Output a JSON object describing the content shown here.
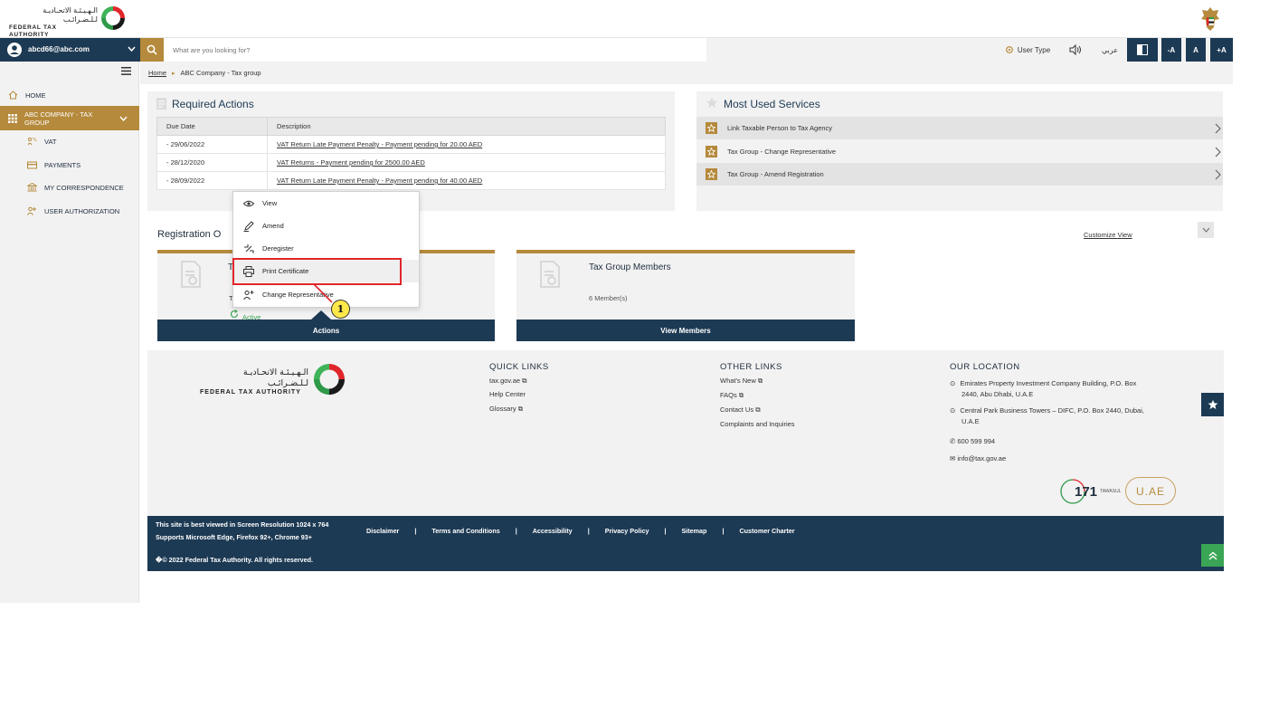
{
  "user": {
    "email": "abcd66@abc.com"
  },
  "search": {
    "placeholder": "What are you looking for?"
  },
  "header_controls": {
    "user_type": "User Type",
    "arabic": "عربي",
    "font_decrease": "-A",
    "font_normal": "A",
    "font_increase": "+A"
  },
  "logo": {
    "arabic": "الـهـيـئـة الاتحـاديـة لـلـضـرائـب",
    "english": "FEDERAL TAX AUTHORITY"
  },
  "breadcrumb": {
    "home": "Home",
    "separator": "▸",
    "current": "ABC Company - Tax group"
  },
  "sidebar": {
    "items": [
      {
        "label": "HOME",
        "icon": "home-icon"
      },
      {
        "label": "ABC COMPANY - TAX GROUP",
        "icon": "grid-icon",
        "active": true
      },
      {
        "label": "VAT",
        "icon": "vat-icon"
      },
      {
        "label": "PAYMENTS",
        "icon": "payments-icon"
      },
      {
        "label": "MY CORRESPONDENCE",
        "icon": "bank-icon"
      },
      {
        "label": "USER AUTHORIZATION",
        "icon": "user-auth-icon"
      }
    ]
  },
  "required_actions": {
    "title": "Required Actions",
    "columns": [
      "Due Date",
      "Description"
    ],
    "rows": [
      {
        "date": "- 29/06/2022",
        "description": "VAT Return Late Payment Penalty - Payment pending for 20.00 AED"
      },
      {
        "date": "- 28/12/2020",
        "description": "VAT Returns - Payment pending for 2500.00 AED"
      },
      {
        "date": "- 28/09/2022",
        "description": "VAT Return Late Payment Penalty - Payment pending for 40.00 AED"
      }
    ]
  },
  "most_used": {
    "title": "Most Used Services",
    "items": [
      "Link Taxable Person to Tax Agency",
      "Tax Group - Change Representative",
      "Tax Group - Amend Registration"
    ]
  },
  "registration": {
    "title": "Registration O",
    "customize": "Customize View",
    "card1": {
      "title_fragment": "T",
      "sub_fragment": "T",
      "status": "Active",
      "button": "Actions"
    },
    "card2": {
      "title": "Tax Group Members",
      "members": "6 Member(s)",
      "button": "View Members"
    }
  },
  "actions_menu": {
    "items": [
      {
        "label": "View",
        "icon": "eye-icon"
      },
      {
        "label": "Amend",
        "icon": "edit-icon"
      },
      {
        "label": "Deregister",
        "icon": "deregister-icon"
      },
      {
        "label": "Print Certificate",
        "icon": "print-icon",
        "highlighted": true
      },
      {
        "label": "Change Representative",
        "icon": "user-change-icon"
      }
    ],
    "callout": "1"
  },
  "footer": {
    "quick_links": {
      "title": "QUICK LINKS",
      "items": [
        "tax.gov.ae",
        "Help Center",
        "Glossary"
      ]
    },
    "other_links": {
      "title": "OTHER LINKS",
      "items": [
        "What's New",
        "FAQs",
        "Contact Us",
        "Complaints and Inquiries"
      ]
    },
    "location": {
      "title": "OUR LOCATION",
      "address1_line1": "Emirates Property Investment Company Building, P.O. Box",
      "address1_line2": "2440, Abu Dhabi, U.A.E",
      "address2_line1": "Central Park Business Towers – DIFC, P.O. Box 2440, Dubai,",
      "address2_line2": "U.A.E",
      "phone": "600 599 994",
      "email": "info@tax.gov.ae"
    },
    "tawasul": "171",
    "tawasul_label": "TAWASUL",
    "uae": "U.AE"
  },
  "bottom_bar": {
    "resolution": "This site is best viewed in Screen Resolution 1024 x 764",
    "browsers": "Supports Microsoft Edge, Firefox 92+, Chrome 93+",
    "copyright": "�© 2022 Federal Tax Authority. All rights reserved.",
    "links": [
      "Disclaimer",
      "Terms and Conditions",
      "Accessibility",
      "Privacy Policy",
      "Sitemap",
      "Customer Charter"
    ],
    "separator": "|"
  },
  "colors": {
    "navy": "#1d3a54",
    "gold": "#b58a3c",
    "green_active": "#3aa655",
    "highlight_red": "#e0262b",
    "callout_yellow": "#ffe94a"
  }
}
